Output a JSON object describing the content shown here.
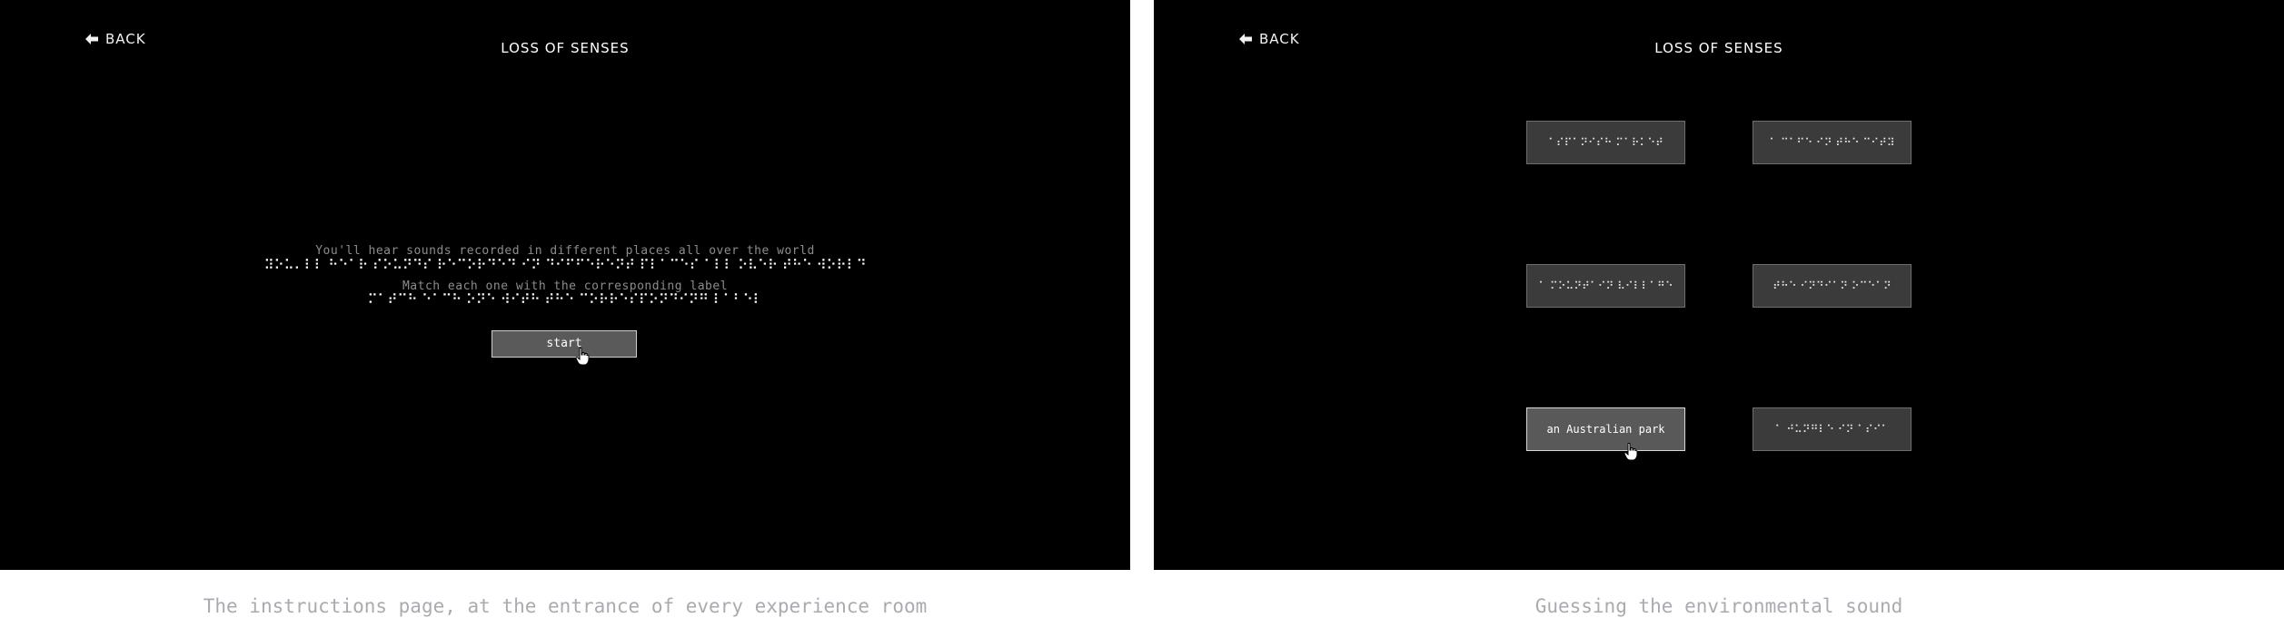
{
  "left_screen": {
    "back_label": "BACK",
    "title": "LOSS OF SENSES",
    "instruction_1": "You'll hear sounds recorded in different places all over the world",
    "instruction_1_braille": "⠽⠕⠥⠄⠇⠇ ⠓⠑⠁⠗ ⠎⠕⠥⠝⠙⠎ ⠗⠑⠉⠕⠗⠙⠑⠙ ⠊⠝ ⠙⠊⠋⠋⠑⠗⠑⠝⠞ ⠏⠇⠁⠉⠑⠎ ⠁⠇⠇ ⠕⠧⠑⠗ ⠞⠓⠑ ⠺⠕⠗⠇⠙",
    "instruction_2": "Match each one with the corresponding label",
    "instruction_2_braille": "⠍⠁⠞⠉⠓ ⠑⠁⠉⠓ ⠕⠝⠑ ⠺⠊⠞⠓ ⠞⠓⠑ ⠉⠕⠗⠗⠑⠎⠏⠕⠝⠙⠊⠝⠛ ⠇⠁⠃⠑⠇",
    "start_label": "start"
  },
  "right_screen": {
    "back_label": "BACK",
    "title": "LOSS OF SENSES",
    "cards": [
      {
        "label": "⠁⠎⠏⠁⠝⠊⠎⠓ ⠍⠁⠗⠅⠑⠞",
        "active": false
      },
      {
        "label": "⠁ ⠉⠁⠋⠑ ⠊⠝ ⠞⠓⠑ ⠉⠊⠞⠽",
        "active": false
      },
      {
        "label": "⠁ ⠍⠕⠥⠝⠞⠁⠊⠝ ⠧⠊⠇⠇⠁⠛⠑",
        "active": false
      },
      {
        "label": "⠞⠓⠑ ⠊⠝⠙⠊⠁⠝ ⠕⠉⠑⠁⠝",
        "active": false
      },
      {
        "label": "an Australian park",
        "active": true
      },
      {
        "label": "⠁ ⠚⠥⠝⠛⠇⠑ ⠊⠝ ⠁⠎⠊⠁",
        "active": false
      }
    ]
  },
  "captions": {
    "left": "The instructions page, at the entrance of every experience room",
    "right": "Guessing the environmental sound"
  }
}
